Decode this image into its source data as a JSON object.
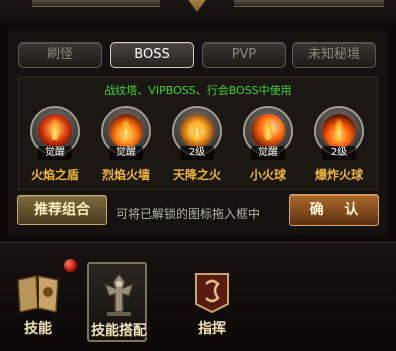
{
  "tabs": [
    {
      "label": "刷怪",
      "active": false
    },
    {
      "label": "BOSS",
      "active": true
    },
    {
      "label": "PVP",
      "active": false
    },
    {
      "label": "未知秘境",
      "active": false
    }
  ],
  "hint": "战纹塔、VIPBOSS、行会BOSS中使用",
  "skills": [
    {
      "name": "火焰之盾",
      "badge": "觉醒",
      "icon": "flame-shield-icon"
    },
    {
      "name": "烈焰火墙",
      "badge": "觉醒",
      "icon": "flame-wall-icon"
    },
    {
      "name": "天降之火",
      "badge": "2级",
      "icon": "falling-fire-icon"
    },
    {
      "name": "小火球",
      "badge": "觉醒",
      "icon": "small-fireball-icon"
    },
    {
      "name": "爆炸火球",
      "badge": "2级",
      "icon": "exploding-fireball-icon"
    }
  ],
  "actions": {
    "recommend_label": "推荐组合",
    "drag_hint": "可将已解锁的图标拖入框中",
    "confirm_label": "确 认"
  },
  "bottom_nav": [
    {
      "label": "技能",
      "icon": "spellbook-icon",
      "selected": false
    },
    {
      "label": "技能搭配",
      "icon": "armor-totem-icon",
      "selected": true
    },
    {
      "label": "指挥",
      "icon": "war-banner-icon",
      "selected": false
    }
  ],
  "colors": {
    "hint_green": "#3fd232",
    "skill_name_gold": "#f0b43a",
    "notification_red": "#d01a0c"
  }
}
